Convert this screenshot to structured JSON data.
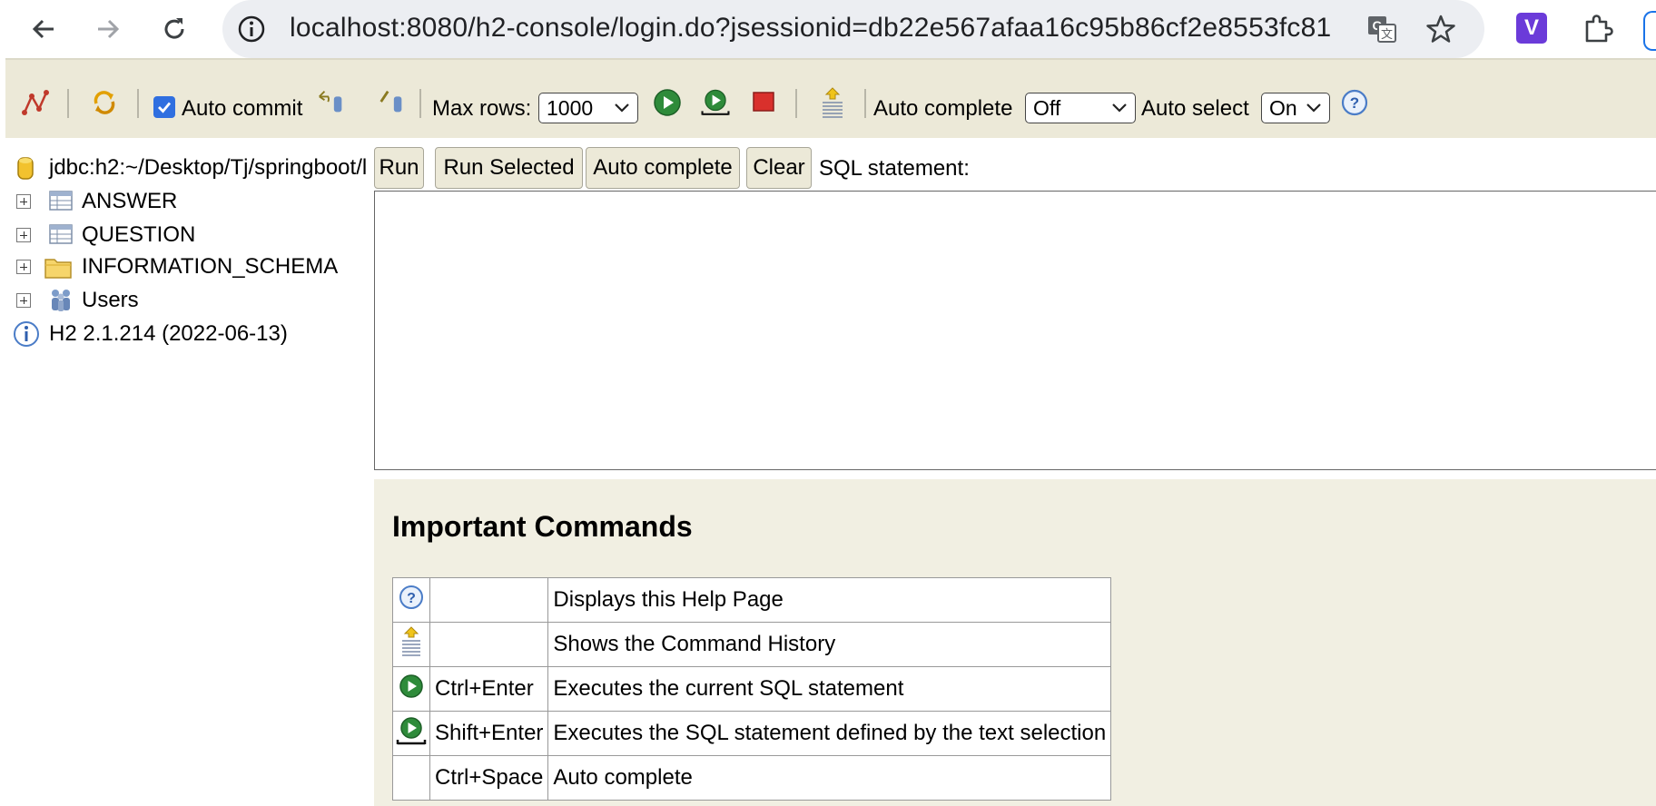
{
  "browser": {
    "url": "localhost:8080/h2-console/login.do?jsessionid=db22e567afaa16c95b86cf2e8553fc81",
    "extension_letter": "V"
  },
  "toolbar": {
    "auto_commit_label": "Auto commit",
    "auto_commit_checked": true,
    "max_rows_label": "Max rows:",
    "max_rows_value": "1000",
    "auto_complete_label": "Auto complete",
    "auto_complete_value": "Off",
    "auto_select_label": "Auto select",
    "auto_select_value": "On"
  },
  "tree": {
    "connection": "jdbc:h2:~/Desktop/Tj/springboot/l",
    "items": [
      {
        "label": "ANSWER",
        "icon": "table-icon"
      },
      {
        "label": "QUESTION",
        "icon": "table-icon"
      },
      {
        "label": "INFORMATION_SCHEMA",
        "icon": "folder-icon"
      },
      {
        "label": "Users",
        "icon": "users-icon"
      }
    ],
    "version": "H2 2.1.214 (2022-06-13)"
  },
  "main": {
    "buttons": {
      "run": "Run",
      "run_selected": "Run Selected",
      "auto_complete": "Auto complete",
      "clear": "Clear"
    },
    "sql_label": "SQL statement:",
    "sql_value": ""
  },
  "help": {
    "title": "Important Commands",
    "rows": [
      {
        "icon": "help-icon",
        "key": "",
        "desc": "Displays this Help Page"
      },
      {
        "icon": "history-icon",
        "key": "",
        "desc": "Shows the Command History"
      },
      {
        "icon": "run-icon",
        "key": "Ctrl+Enter",
        "desc": "Executes the current SQL statement"
      },
      {
        "icon": "run-selected-icon",
        "key": "Shift+Enter",
        "desc": "Executes the SQL statement defined by the text selection"
      },
      {
        "icon": "",
        "key": "Ctrl+Space",
        "desc": "Auto complete"
      }
    ]
  },
  "colors": {
    "toolbar_bg": "#ece9d8",
    "help_bg": "#f1efe2",
    "checkbox": "#2f6fe0",
    "run_green": "#2e8b3a",
    "stop_red": "#d9302c"
  }
}
